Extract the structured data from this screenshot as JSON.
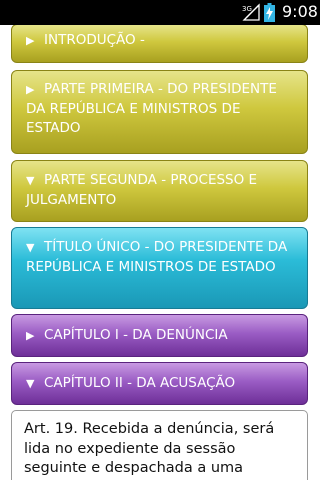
{
  "status_bar": {
    "network": "3G",
    "time": "9:08",
    "icons": [
      "signal-3g-icon",
      "battery-charging-icon"
    ]
  },
  "tree": [
    {
      "arrow": "▶",
      "label": "INTRODUÇÃO -"
    },
    {
      "arrow": "▶",
      "label": "PARTE PRIMEIRA - DO PRESIDENTE DA REPÚBLICA E MINISTROS DE ESTADO"
    },
    {
      "arrow": "▼",
      "label": "PARTE SEGUNDA - PROCESSO E JULGAMENTO"
    },
    {
      "arrow": "▼",
      "label": "TÍTULO ÚNICO - DO PRESIDENTE DA REPÚBLICA E MINISTROS DE ESTADO"
    },
    {
      "arrow": "▶",
      "label": "CAPÍTULO I - DA DENÚNCIA"
    },
    {
      "arrow": "▼",
      "label": "CAPÍTULO II - DA ACUSAÇÃO"
    }
  ],
  "article": {
    "text": "Art. 19. Recebida a denúncia, será lida no expediente da sessão seguinte e despachada a uma"
  },
  "colors": {
    "level1": "#cfc83e",
    "level2": "#2bbcd8",
    "level3": "#9a5cc4"
  }
}
